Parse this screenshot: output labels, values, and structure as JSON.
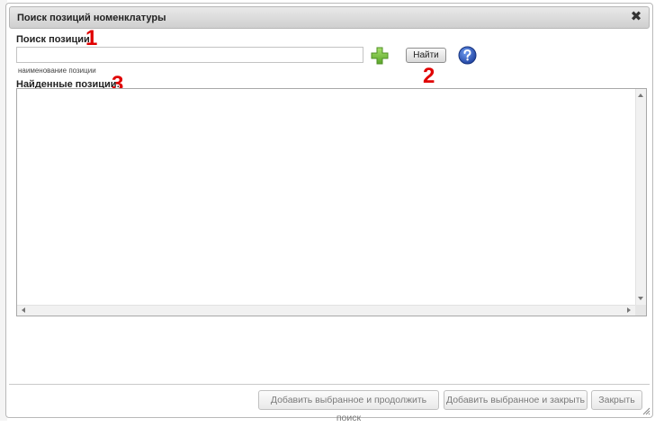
{
  "dialog": {
    "title": "Поиск позиций номенклатуры",
    "close_glyph": "✖"
  },
  "search": {
    "label": "Поиск позиции",
    "value": "",
    "placeholder": "",
    "hint": "наименование позиции",
    "add_icon": "plus-icon",
    "find_label": "Найти",
    "help_icon": "help-icon"
  },
  "results": {
    "label": "Найденные позиции:",
    "items": []
  },
  "markers": [
    "1",
    "2",
    "3"
  ],
  "footer": {
    "add_continue_label": "Добавить выбранное и продолжить поиск",
    "add_close_label": "Добавить выбранное и закрыть",
    "close_label": "Закрыть"
  },
  "colors": {
    "marker": "#e00000",
    "plus": "#7cc242",
    "help": "#1f4fb2"
  }
}
